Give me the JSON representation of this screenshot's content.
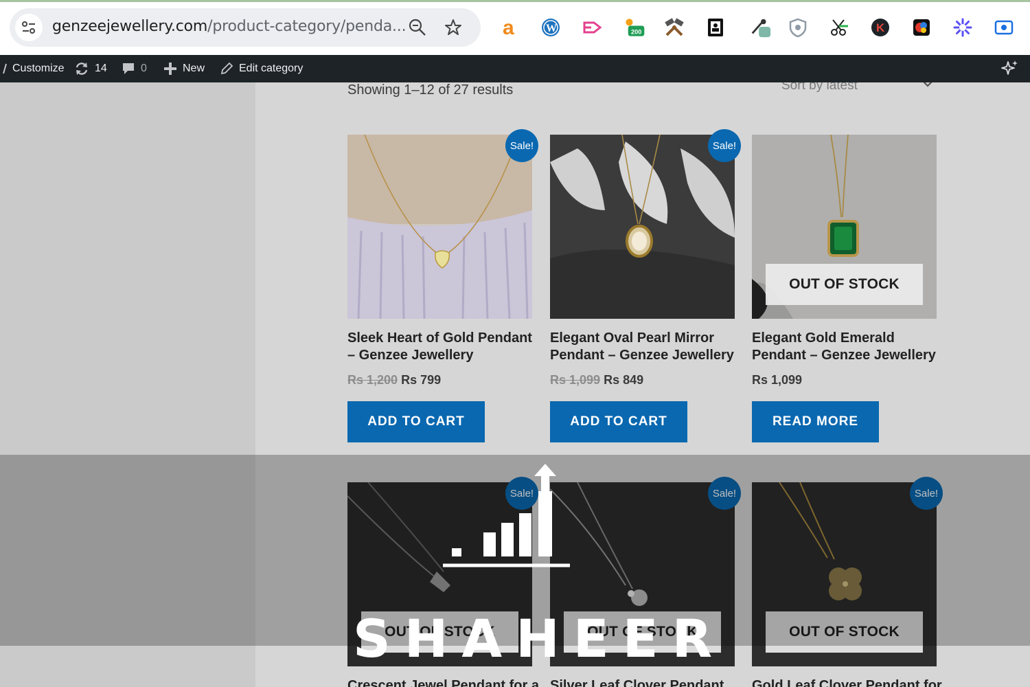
{
  "browser": {
    "url_host": "genzeejewellery.com",
    "url_path": "/product-category/penda...",
    "icons": [
      "site-info-icon",
      "zoom-icon",
      "bookmark-star-icon"
    ],
    "extensions": [
      {
        "name": "amazon-assistant-icon"
      },
      {
        "name": "wordpress-icon"
      },
      {
        "name": "tag-arrow-icon"
      },
      {
        "name": "tracker-icon",
        "badge": "200"
      },
      {
        "name": "tools-icon"
      },
      {
        "name": "contact-book-icon"
      },
      {
        "name": "eyedropper-icon"
      },
      {
        "name": "shield-icon"
      },
      {
        "name": "scissors-icon"
      },
      {
        "name": "k-icon"
      },
      {
        "name": "puzzle-color-icon"
      },
      {
        "name": "sparkle-gear-icon"
      },
      {
        "name": "screen-record-icon"
      }
    ]
  },
  "adminbar": {
    "customize": "Customize",
    "updates_count": "14",
    "comments_count": "0",
    "new_label": "New",
    "edit_label": "Edit category"
  },
  "shop": {
    "result_count": "Showing 1–12 of 27 results",
    "sort_label": "Sort by latest"
  },
  "products": [
    {
      "title": "Sleek Heart of Gold Pendant – Genzee Jewellery",
      "old_price": "Rs 1,200",
      "price": "Rs 799",
      "sale": "Sale!",
      "button": "ADD TO CART"
    },
    {
      "title": "Elegant Oval Pearl Mirror Pendant – Genzee Jewellery",
      "old_price": "Rs 1,099",
      "price": "Rs 849",
      "sale": "Sale!",
      "button": "ADD TO CART"
    },
    {
      "title": "Elegant Gold Emerald Pendant – Genzee Jewellery",
      "price": "Rs 1,099",
      "stock": "OUT OF STOCK",
      "button": "READ MORE"
    },
    {
      "title": "Crescent Jewel Pendant for a",
      "sale": "Sale!",
      "stock": "OUT OF STOCK"
    },
    {
      "title": "Silver Leaf Clover Pendant for",
      "sale": "Sale!",
      "stock": "OUT OF STOCK"
    },
    {
      "title": "Gold Leaf Clover Pendant for",
      "sale": "Sale!",
      "stock": "OUT OF STOCK"
    }
  ],
  "watermark": {
    "text": "SHAHEER"
  },
  "colors": {
    "button": "#0a68b0",
    "adminbar": "#1d2327"
  }
}
